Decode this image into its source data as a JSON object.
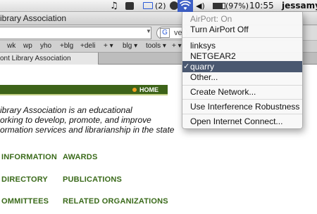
{
  "menubar": {
    "mail_count": "(2)",
    "battery_percent": "(97%)",
    "time": "10:55",
    "user": "jessamyn",
    "icons": [
      "music-note-icon",
      "app-icon",
      "mail-icon",
      "app-icon",
      "wifi-icon",
      "volume-icon",
      "bluetooth-icon",
      "battery-icon"
    ]
  },
  "browser": {
    "window_title": "ibrary Association",
    "search_text": "ve",
    "bookmarks": [
      "wk",
      "wp",
      "yho",
      "+blg",
      "+deli",
      "+ ▾",
      "blg ▾",
      "tools ▾",
      "+ ▾"
    ],
    "tab_title": "ont Library Association"
  },
  "page": {
    "nav_home": "HOME",
    "intro_lines": [
      "ibrary Association is an educational",
      "orking to develop, promote, and improve",
      "ormation services and librarianship in the state"
    ],
    "links_left": [
      "INFORMATION",
      "DIRECTORY",
      "OMMITTEES"
    ],
    "links_right": [
      "AWARDS",
      "PUBLICATIONS",
      "RELATED ORGANIZATIONS"
    ]
  },
  "airport_menu": {
    "status": "AirPort: On",
    "toggle": "Turn AirPort Off",
    "networks": [
      "linksys",
      "NETGEAR2",
      "quarry",
      "Other..."
    ],
    "selected_network": "quarry",
    "create": "Create Network...",
    "interference": "Use Interference Robustness",
    "open_connect": "Open Internet Connect..."
  },
  "colors": {
    "nav_green": "#3d6319",
    "link_green": "#3a6a1a",
    "menu_highlight": "#4a5870",
    "wifi_active": "#3d5fc6"
  }
}
